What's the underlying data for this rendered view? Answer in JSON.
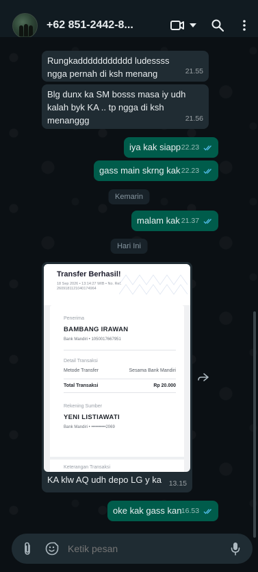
{
  "header": {
    "contact_name": "+62 851-2442-8...",
    "icons": [
      "video-call-icon",
      "dropdown-caret-icon",
      "search-icon",
      "more-options-icon"
    ]
  },
  "messages": [
    {
      "dir": "in",
      "text": "Rungkaddddddddddd ludessss ngga pernah di ksh menang",
      "time": "21.55"
    },
    {
      "dir": "in",
      "text": "Blg dunx ka SM bosss masa iy udh kalah byk KA .. tp ngga di ksh menanggg",
      "time": "21.56"
    },
    {
      "dir": "out",
      "text": "iya kak siapp",
      "time": "22.23"
    },
    {
      "dir": "out",
      "text": "gass main skrng kak",
      "time": "22.23"
    },
    {
      "dir": "out",
      "text": "malam kak",
      "time": "21.37"
    },
    {
      "dir": "out",
      "text": "oke kak gass kan",
      "time": "16.53"
    }
  ],
  "date_chips": {
    "yesterday": "Kemarin",
    "today": "Hari Ini"
  },
  "image_message": {
    "caption": "KA klw AQ udh depo LG y ka",
    "time": "13.15",
    "receipt": {
      "title": "Transfer Berhasil!",
      "subtitle": "18 Sep 2026 • 13:14:27 WIB • No. Ref. 2609181121040174964",
      "recipient_label": "Penerima",
      "recipient_name": "BAMBANG IRAWAN",
      "recipient_account": "Bank Mandiri • 1050017667951",
      "details_label": "Detail Transaksi",
      "method_label": "Metode Transfer",
      "method_value": "Sesama Bank Mandiri",
      "total_label": "Total Transaksi",
      "total_value": "Rp 20.000",
      "source_label": "Rekening Sumber",
      "source_name": "YENI LISTIAWATI",
      "source_account": "Bank Mandiri • ••••••••••2069",
      "notes_label": "Keterangan Transaksi"
    }
  },
  "input": {
    "placeholder": "Ketik pesan"
  },
  "colors": {
    "incoming": "#202c33",
    "outgoing": "#005c4b",
    "read_ticks": "#53bdeb",
    "background": "#0b1014"
  }
}
